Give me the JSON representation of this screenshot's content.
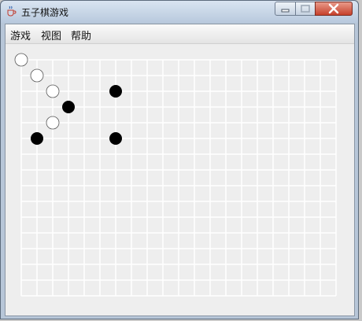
{
  "window": {
    "title": "五子棋游戏"
  },
  "menu": {
    "items": [
      "游戏",
      "视图",
      "帮助"
    ]
  },
  "board": {
    "grid_cols": 21,
    "grid_rows": 16,
    "line_color": "#ffffff",
    "background": "#eeeeee",
    "stones": [
      {
        "col": 0,
        "row": 0,
        "color": "white"
      },
      {
        "col": 1,
        "row": 1,
        "color": "white"
      },
      {
        "col": 2,
        "row": 2,
        "color": "white"
      },
      {
        "col": 3,
        "row": 3,
        "color": "black"
      },
      {
        "col": 2,
        "row": 4,
        "color": "white"
      },
      {
        "col": 1,
        "row": 5,
        "color": "black"
      },
      {
        "col": 6,
        "row": 2,
        "color": "black"
      },
      {
        "col": 6,
        "row": 5,
        "color": "black"
      }
    ]
  },
  "icons": {
    "app": "java-cup-icon",
    "minimize": "minimize-icon",
    "maximize": "maximize-icon",
    "close": "close-icon"
  }
}
